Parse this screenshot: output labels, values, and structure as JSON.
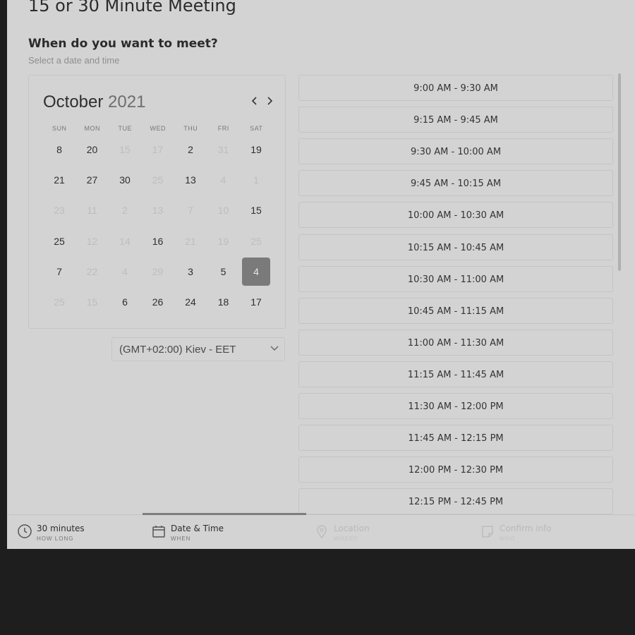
{
  "page": {
    "title": "15 or 30 Minute Meeting",
    "question": "When do you want to meet?",
    "subtitle": "Select a date and time"
  },
  "calendar": {
    "month": "October",
    "year": "2021",
    "prev_icon": "chevron-left-icon",
    "next_icon": "chevron-right-icon",
    "weekdays": [
      "SUN",
      "MON",
      "TUE",
      "WED",
      "THU",
      "FRI",
      "SAT"
    ],
    "weeks": [
      [
        {
          "d": "8",
          "available": true
        },
        {
          "d": "20",
          "available": true
        },
        {
          "d": "15",
          "available": false
        },
        {
          "d": "17",
          "available": false
        },
        {
          "d": "2",
          "available": true
        },
        {
          "d": "31",
          "available": false
        },
        {
          "d": "19",
          "available": true
        }
      ],
      [
        {
          "d": "21",
          "available": true
        },
        {
          "d": "27",
          "available": true
        },
        {
          "d": "30",
          "available": true
        },
        {
          "d": "25",
          "available": false
        },
        {
          "d": "13",
          "available": true
        },
        {
          "d": "4",
          "available": false
        },
        {
          "d": "1",
          "available": false
        }
      ],
      [
        {
          "d": "23",
          "available": false
        },
        {
          "d": "11",
          "available": false
        },
        {
          "d": "2",
          "available": false
        },
        {
          "d": "13",
          "available": false
        },
        {
          "d": "7",
          "available": false
        },
        {
          "d": "10",
          "available": false
        },
        {
          "d": "15",
          "available": true
        }
      ],
      [
        {
          "d": "25",
          "available": true
        },
        {
          "d": "12",
          "available": false
        },
        {
          "d": "14",
          "available": false
        },
        {
          "d": "16",
          "available": true
        },
        {
          "d": "21",
          "available": false
        },
        {
          "d": "19",
          "available": false
        },
        {
          "d": "25",
          "available": false
        }
      ],
      [
        {
          "d": "7",
          "available": true
        },
        {
          "d": "22",
          "available": false
        },
        {
          "d": "4",
          "available": false
        },
        {
          "d": "29",
          "available": false
        },
        {
          "d": "3",
          "available": true
        },
        {
          "d": "5",
          "available": true
        },
        {
          "d": "4",
          "available": true,
          "selected": true
        }
      ],
      [
        {
          "d": "25",
          "available": false
        },
        {
          "d": "15",
          "available": false
        },
        {
          "d": "6",
          "available": true
        },
        {
          "d": "26",
          "available": true
        },
        {
          "d": "24",
          "available": true
        },
        {
          "d": "18",
          "available": true
        },
        {
          "d": "17",
          "available": true
        }
      ]
    ]
  },
  "timezone": {
    "value": "(GMT+02:00) Kiev - EET",
    "icon": "chevron-down-icon"
  },
  "slots": [
    "9:00 AM - 9:30 AM",
    "9:15 AM - 9:45 AM",
    "9:30 AM - 10:00 AM",
    "9:45 AM - 10:15 AM",
    "10:00 AM - 10:30 AM",
    "10:15 AM - 10:45 AM",
    "10:30 AM - 11:00 AM",
    "10:45 AM - 11:15 AM",
    "11:00 AM - 11:30 AM",
    "11:15 AM - 11:45 AM",
    "11:30 AM - 12:00 PM",
    "11:45 AM - 12:15 PM",
    "12:00 PM - 12:30 PM",
    "12:15 PM - 12:45 PM"
  ],
  "steps": [
    {
      "label": "30 minutes",
      "sub": "HOW LONG",
      "icon": "clock-icon",
      "state": "done"
    },
    {
      "label": "Date & Time",
      "sub": "WHEN",
      "icon": "calendar-icon",
      "state": "active"
    },
    {
      "label": "Location",
      "sub": "WHERE",
      "icon": "location-pin-icon",
      "state": "inactive"
    },
    {
      "label": "Confirm info",
      "sub": "WHO",
      "icon": "note-icon",
      "state": "inactive"
    }
  ],
  "colors": {
    "panel_bg": "#d3d3d3",
    "outer_bg": "#1e1e1e",
    "selected_day": "#7a7a7a",
    "text": "#2e2e2e",
    "muted": "#bdbdbd"
  }
}
